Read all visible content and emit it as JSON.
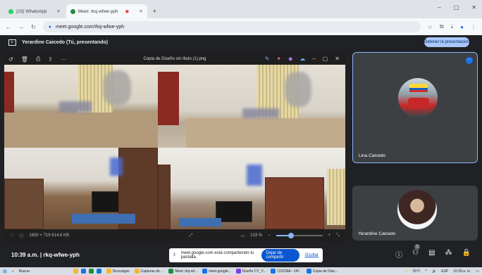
{
  "browser": {
    "tabs": [
      {
        "label": "(23) WhatsApp",
        "color": "#25d366"
      },
      {
        "label": "Meet: rkq-wfwe-yph",
        "color": "#1e8e3e"
      }
    ],
    "new_tab": "+",
    "url": "meet.google.com/rkq-wfwe-yph"
  },
  "meet": {
    "presenting_label": "Yerardine Caicedo (Tú, presentando)",
    "stop_presenting": "Detener la presentación",
    "viewer": {
      "file_title": "Copia de Diseño sin título (1).png",
      "info": "1600 × 719   614.6 KB",
      "zoom": "133 %",
      "zoom_fraction": 0.32
    },
    "participants": [
      {
        "name": "Lina Caicedo"
      },
      {
        "name": "Yerardine Caicedo"
      }
    ],
    "more_icon": "···",
    "meeting_info": "10:39 a.m.  |  rkq-wfwe-yph",
    "participant_count": "3",
    "share_banner": {
      "text": "meet.google.com está compartiendo tu pantalla.",
      "stop": "Dejar de compartir",
      "hide": "Ocultar"
    }
  },
  "taskbar": {
    "search": "Buscar",
    "apps": [
      {
        "label": "Descargas",
        "color": "#f2b632"
      },
      {
        "label": "Capturas de ...",
        "color": "#f2b632"
      },
      {
        "label": "Meet: rkq-wf...",
        "color": "#1e8e3e"
      },
      {
        "label": "meet.google...",
        "color": "#1a73e8"
      },
      {
        "label": "Diseño CY_Y...",
        "color": "#7b3fe4"
      },
      {
        "label": "COCINA - OP...",
        "color": "#1a73e8"
      },
      {
        "label": "Copia de Dise...",
        "color": "#1a73e8"
      }
    ],
    "weather": "25°C",
    "lang": "ESP",
    "clock": "10:39 a. m."
  }
}
